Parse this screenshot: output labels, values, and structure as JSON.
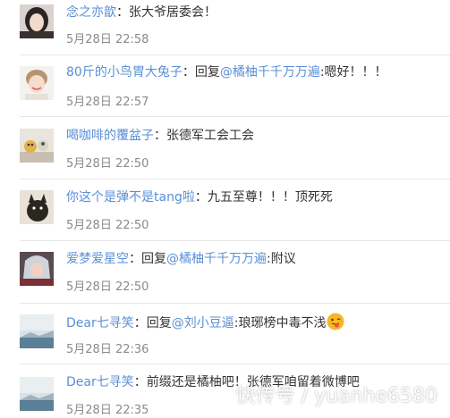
{
  "comments": [
    {
      "avatar_icon": "avatar-girl-dark-hair-icon",
      "user": "念之亦歆",
      "sep": "：",
      "text": "张大爷居委会！",
      "time": "5月28日 22:58"
    },
    {
      "avatar_icon": "avatar-smiling-girl-icon",
      "user": "80斤的小鸟胃大兔子",
      "sep": "：",
      "reply_label": "回复",
      "mention": "@橘柚千千万万遍",
      "mention_sep": ":",
      "text": "嗯好！！！",
      "time": "5月28日 22:57"
    },
    {
      "avatar_icon": "avatar-toys-icon",
      "user": "喝咖啡的覆盆子",
      "sep": "：",
      "text": "张德军工会工会",
      "time": "5月28日 22:50"
    },
    {
      "avatar_icon": "avatar-dark-bird-icon",
      "user": "你这个是弹不是tang啦",
      "sep": "：",
      "text": "九五至尊！！！顶死死",
      "time": "5月28日 22:50"
    },
    {
      "avatar_icon": "avatar-anime-character-icon",
      "user": "爱梦爱星空",
      "sep": "：",
      "reply_label": "回复",
      "mention": "@橘柚千千万万遍",
      "mention_sep": ":",
      "text": "附议",
      "time": "5月28日 22:50"
    },
    {
      "avatar_icon": "avatar-landscape-icon",
      "user": "Dear七寻笑",
      "sep": "：",
      "reply_label": "回复",
      "mention": "@刘小豆逼",
      "mention_sep": ":",
      "text": "琅琊榜中毒不浅",
      "emoji": "tongue-out-emoji-icon",
      "time": "5月28日 22:36"
    },
    {
      "avatar_icon": "avatar-landscape-icon",
      "user": "Dear七寻笑",
      "sep": "：",
      "text": "前缀还是橘柚吧！张德军咱留着微博吧",
      "time": "5月28日 22:35"
    }
  ],
  "watermark": "快传号 / yuanhe6580"
}
